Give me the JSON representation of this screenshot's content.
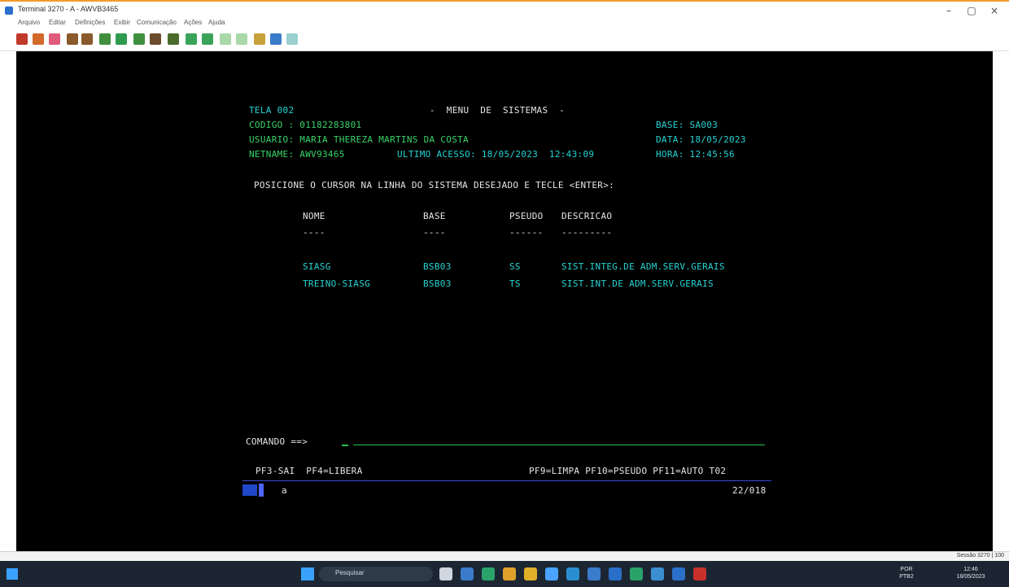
{
  "window": {
    "title": "Terminal 3270 - A - AWVB3465",
    "minimize": "–",
    "maximize": "▢",
    "close": "×"
  },
  "menu": [
    "Arquivo",
    "Editar",
    "Definições",
    "Exibir",
    "Comunicação",
    "Ações",
    "Ajuda"
  ],
  "terminal": {
    "screen_id": "TELA 002",
    "header_title": "-  MENU  DE  SISTEMAS  -",
    "codigo_label": "CODIGO : 01182283801",
    "base_label": "BASE: SA003",
    "usuario_label": "USUARIO: MARIA THEREZA MARTINS DA COSTA",
    "data_label": "DATA: 18/05/2023",
    "netname_label": "NETNAME: AWV93465",
    "ultimo_acesso": "ULTIMO ACESSO: 18/05/2023  12:43:09",
    "hora_label": "HORA: 12:45:56",
    "instruction": "POSICIONE O CURSOR NA LINHA DO SISTEMA DESEJADO E TECLE <ENTER>:",
    "columns": {
      "nome": "NOME",
      "base": "BASE",
      "pseudo": "PSEUDO",
      "descricao": "DESCRICAO",
      "nome_rule": "----",
      "base_rule": "----",
      "pseudo_rule": "------",
      "descricao_rule": "---------"
    },
    "rows": [
      {
        "nome": "SIASG",
        "base": "BSB03",
        "pseudo": "SS",
        "descricao": "SIST.INTEG.DE ADM.SERV.GERAIS"
      },
      {
        "nome": "TREINO-SIASG",
        "base": "BSB03",
        "pseudo": "TS",
        "descricao": "SIST.INT.DE ADM.SERV.GERAIS"
      }
    ],
    "comando_label": "COMANDO ==>",
    "pf_left": "PF3-SAI  PF4=LIBERA",
    "pf_right": "PF9=LIMPA PF10=PSEUDO PF11=AUTO T02",
    "oia_a": "a",
    "cursor_pos": "22/018"
  },
  "statusbar": {
    "right_text": "Sessão 3270 | 100"
  },
  "taskbar": {
    "search_placeholder": "Pesquisar",
    "lang": "POR",
    "lang2": "PTB2",
    "time": "12:46",
    "date": "18/05/2023"
  }
}
